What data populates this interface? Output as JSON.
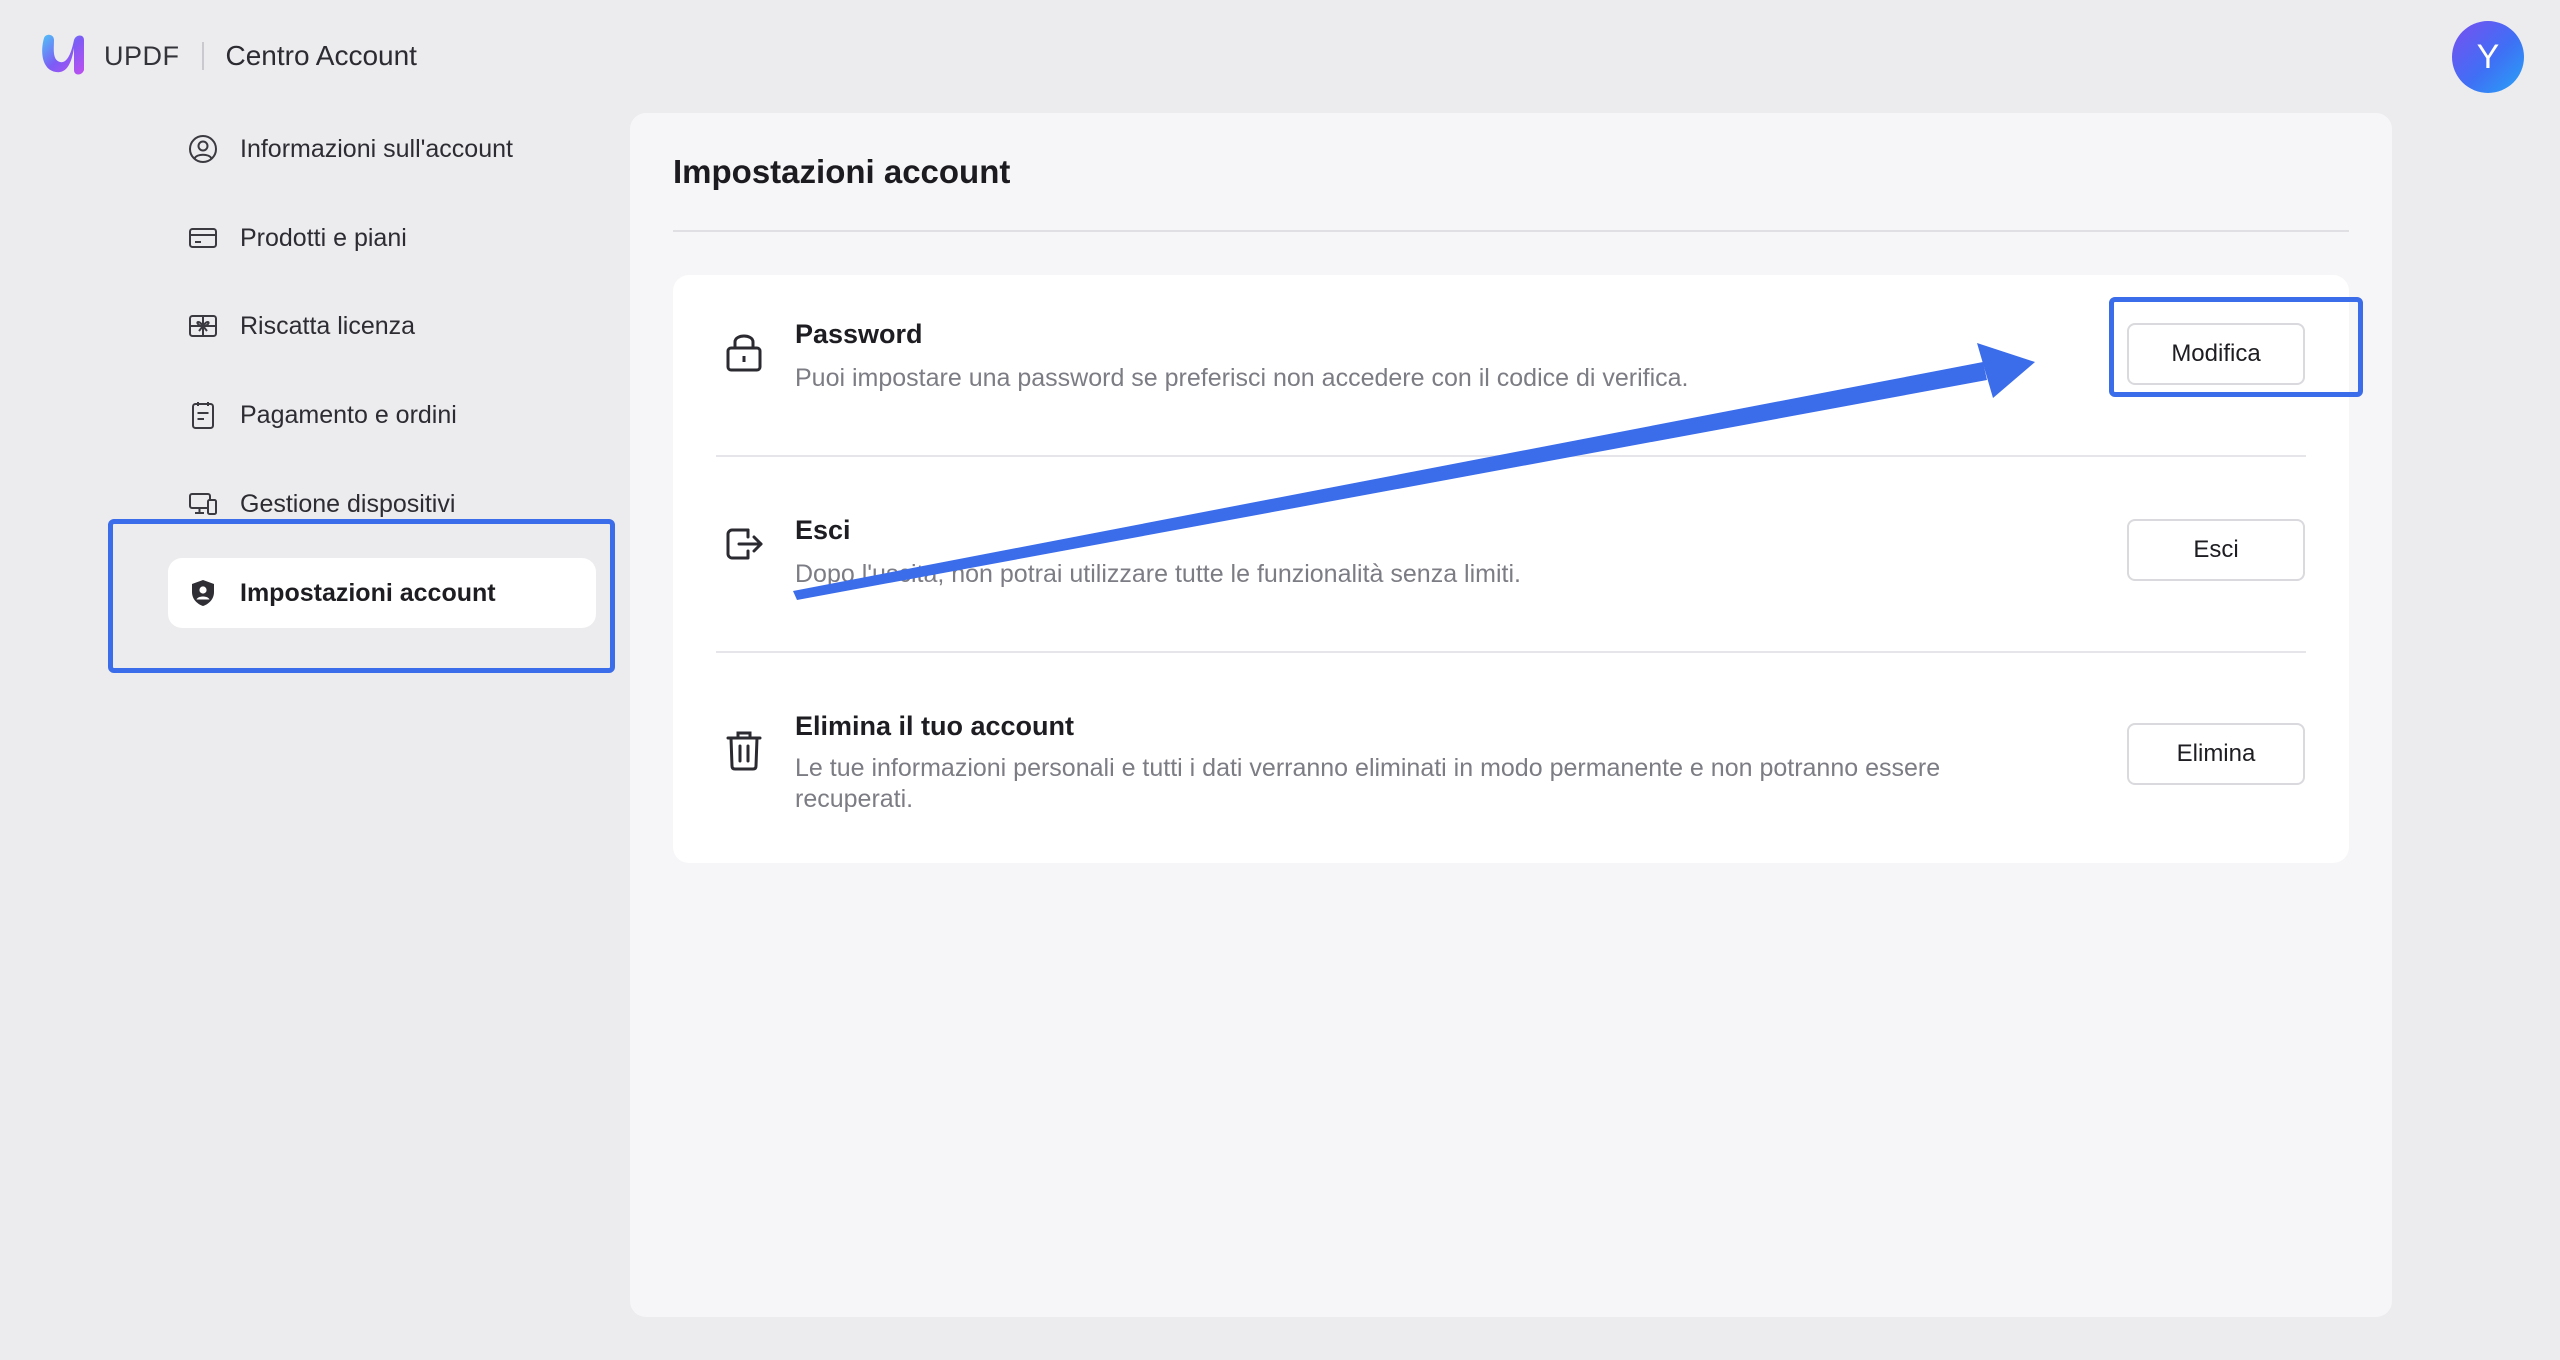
{
  "header": {
    "brand": "UPDF",
    "section": "Centro Account",
    "avatar_initial": "Y"
  },
  "sidebar": {
    "items": [
      {
        "label": "Informazioni sull'account",
        "icon": "user-circle-icon"
      },
      {
        "label": "Prodotti e piani",
        "icon": "credit-card-icon"
      },
      {
        "label": "Riscatta licenza",
        "icon": "gift-card-icon"
      },
      {
        "label": "Pagamento e ordini",
        "icon": "clipboard-icon"
      },
      {
        "label": "Gestione dispositivi",
        "icon": "devices-icon"
      },
      {
        "label": "Impostazioni account",
        "icon": "shield-user-icon",
        "active": true
      }
    ]
  },
  "main": {
    "title": "Impostazioni account",
    "rows": [
      {
        "title": "Password",
        "description": "Puoi impostare una password se preferisci non accedere con il codice di verifica.",
        "button": "Modifica",
        "icon": "lock-icon"
      },
      {
        "title": "Esci",
        "description": "Dopo l'uscita, non potrai utilizzare tutte le funzionalità senza limiti.",
        "button": "Esci",
        "icon": "logout-icon"
      },
      {
        "title": "Elimina il tuo account",
        "description": "Le tue informazioni personali e tutti i dati verranno eliminati in modo permanente e non potranno essere recuperati.",
        "button": "Elimina",
        "icon": "trash-icon"
      }
    ]
  },
  "annotation": {
    "color": "#3b6cea"
  }
}
